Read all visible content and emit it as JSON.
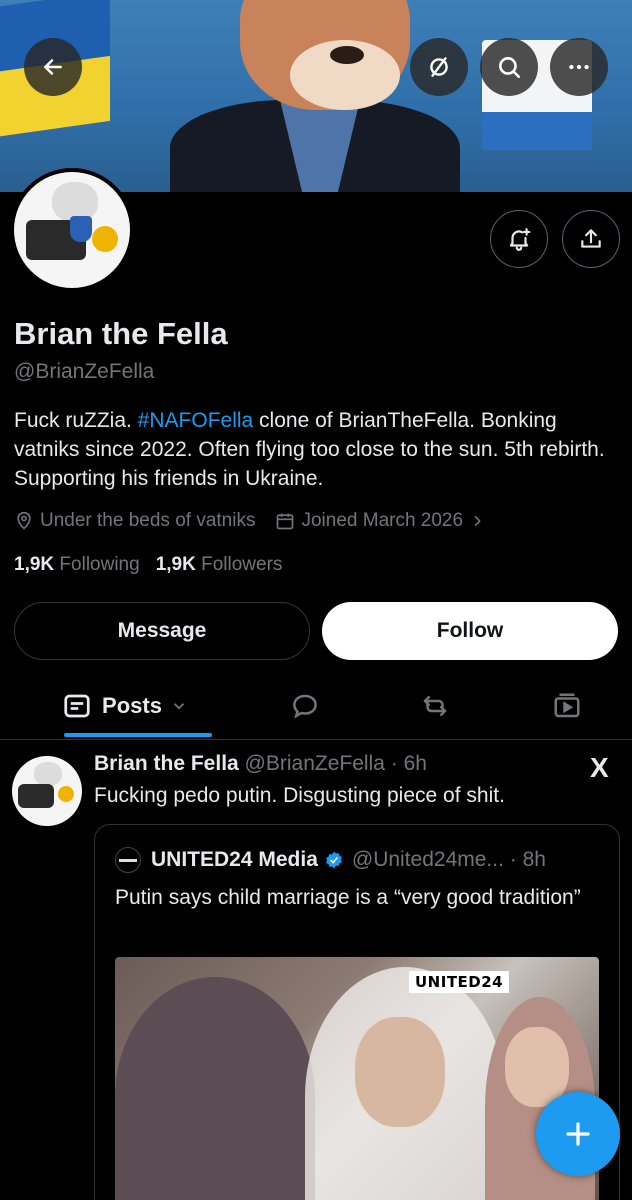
{
  "header": {
    "back_icon": "arrow-left-icon",
    "circle_icon": "no-sign-icon",
    "search_icon": "search-icon",
    "more_icon": "more-horizontal-icon"
  },
  "profile": {
    "name": "Brian the Fella",
    "handle": "@BrianZeFella",
    "bio_pre": "Fuck ruZZia. ",
    "bio_tag": "#NAFOFella",
    "bio_post": " clone of BrianTheFella. Bonking vatniks since 2022. Often flying too close to the sun. 5th rebirth. Supporting his friends in Ukraine.",
    "location": "Under the beds of vatniks",
    "joined": "Joined March 2026",
    "following_count": "1,9K",
    "following_label": "Following",
    "followers_count": "1,9K",
    "followers_label": "Followers",
    "message_label": "Message",
    "follow_label": "Follow"
  },
  "tabs": {
    "posts_label": "Posts"
  },
  "post": {
    "author_name": "Brian the Fella",
    "author_meta": " @BrianZeFella · 6h",
    "text": "Fucking pedo putin. Disgusting piece of shit.",
    "x_logo": "X",
    "quote": {
      "author_name": "UNITED24 Media",
      "author_meta": "@United24me... · 8h",
      "text": "Putin says child marriage is a “very good tradition”",
      "media_badge": "UNITED24"
    }
  },
  "colors": {
    "accent": "#1d9bf0",
    "background": "#000000",
    "muted": "#71767b",
    "text": "#e7e9ea"
  }
}
